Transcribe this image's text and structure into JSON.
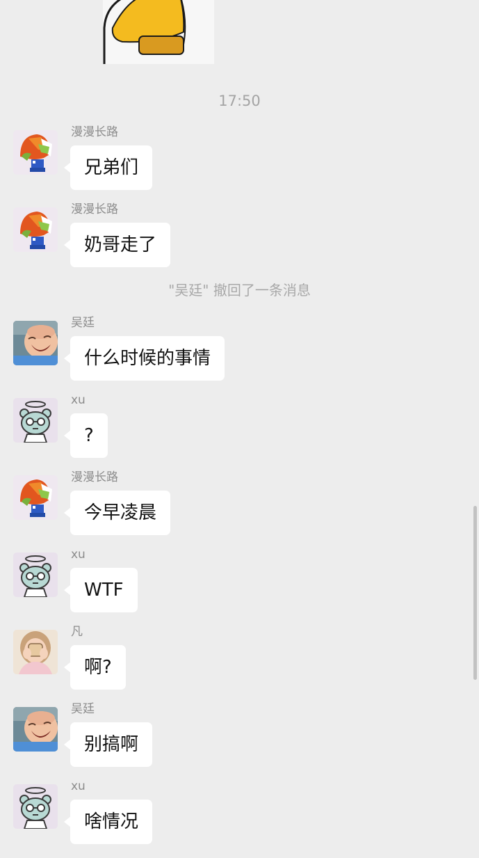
{
  "chat": {
    "timestamp": "17:50",
    "recall_notice": "\"吴廷\" 撤回了一条消息",
    "messages": [
      {
        "sender": "漫漫长路",
        "text": "兄弟们",
        "avatar": "pixel-bird-avatar"
      },
      {
        "sender": "漫漫长路",
        "text": "奶哥走了",
        "avatar": "pixel-bird-avatar"
      },
      {
        "sender": "吴廷",
        "text": "什么时候的事情",
        "avatar": "laughing-baby-avatar"
      },
      {
        "sender": "xu",
        "text": "?",
        "avatar": "angel-bear-avatar"
      },
      {
        "sender": "漫漫长路",
        "text": "今早凌晨",
        "avatar": "pixel-bird-avatar"
      },
      {
        "sender": "xu",
        "text": "WTF",
        "avatar": "angel-bear-avatar"
      },
      {
        "sender": "凡",
        "text": "啊?",
        "avatar": "girl-photo-avatar"
      },
      {
        "sender": "吴廷",
        "text": "别搞啊",
        "avatar": "laughing-baby-avatar"
      },
      {
        "sender": "xu",
        "text": "啥情况",
        "avatar": "angel-bear-avatar"
      }
    ]
  },
  "colors": {
    "background": "#ededed",
    "bubble": "#ffffff",
    "system_text": "#a4a4a4"
  }
}
